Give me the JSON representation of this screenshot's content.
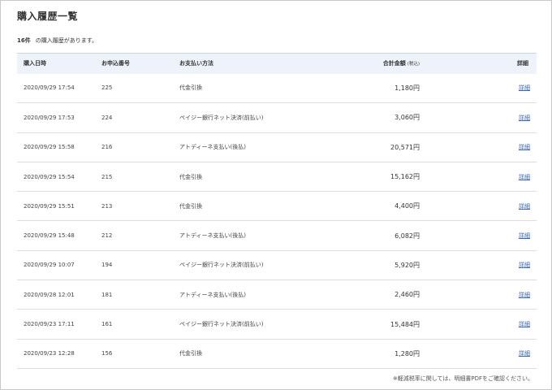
{
  "page": {
    "title": "購入履歴一覧",
    "count": "16件",
    "count_suffix": "の購入履歴があります。",
    "note": "※軽減税率に関しては、明細書PDFをご確認ください。"
  },
  "table": {
    "headers": {
      "date": "購入日時",
      "order_no": "お申込番号",
      "payment": "お支払い方法",
      "amount": "合計金額",
      "amount_tax": "(税込)",
      "detail": "詳細"
    },
    "rows": [
      {
        "date": "2020/09/29 17:54",
        "order_no": "225",
        "payment": "代金引換",
        "amount": "1,180円",
        "detail": "詳細"
      },
      {
        "date": "2020/09/29 17:53",
        "order_no": "224",
        "payment": "ペイジー銀行ネット決済(前払い)",
        "amount": "3,060円",
        "detail": "詳細"
      },
      {
        "date": "2020/09/29 15:58",
        "order_no": "216",
        "payment": "アトディーネ支払い(後払)",
        "amount": "20,571円",
        "detail": "詳細"
      },
      {
        "date": "2020/09/29 15:54",
        "order_no": "215",
        "payment": "代金引換",
        "amount": "15,162円",
        "detail": "詳細"
      },
      {
        "date": "2020/09/29 15:51",
        "order_no": "213",
        "payment": "代金引換",
        "amount": "4,400円",
        "detail": "詳細"
      },
      {
        "date": "2020/09/29 15:48",
        "order_no": "212",
        "payment": "アトディーネ支払い(後払)",
        "amount": "6,082円",
        "detail": "詳細"
      },
      {
        "date": "2020/09/29 10:07",
        "order_no": "194",
        "payment": "ペイジー銀行ネット決済(前払い)",
        "amount": "5,920円",
        "detail": "詳細"
      },
      {
        "date": "2020/09/28 12:01",
        "order_no": "181",
        "payment": "アトディーネ支払い(後払)",
        "amount": "2,460円",
        "detail": "詳細"
      },
      {
        "date": "2020/09/23 17:11",
        "order_no": "161",
        "payment": "ペイジー銀行ネット決済(前払い)",
        "amount": "15,484円",
        "detail": "詳細"
      },
      {
        "date": "2020/09/23 12:28",
        "order_no": "156",
        "payment": "代金引換",
        "amount": "1,280円",
        "detail": "詳細"
      }
    ]
  },
  "colors": {
    "header_bg": "#eef3fb",
    "link": "#3366bb",
    "row_border": "#dedede"
  }
}
